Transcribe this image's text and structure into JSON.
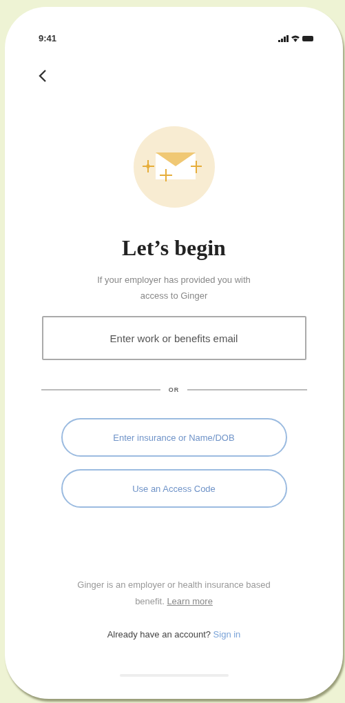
{
  "status_bar": {
    "time": "9:41"
  },
  "title": "Let’s begin",
  "subtitle": "If your employer has provided you with access to Ginger",
  "email_field": {
    "placeholder": "Enter work or benefits email"
  },
  "divider_label": "OR",
  "buttons": [
    "Enter insurance or Name/DOB",
    "Use an Access Code"
  ],
  "footer": {
    "text": "Ginger is an employer or health insurance based benefit.",
    "link": "Learn more"
  },
  "signin": {
    "prompt": "Already have an account?",
    "link": "Sign in"
  }
}
